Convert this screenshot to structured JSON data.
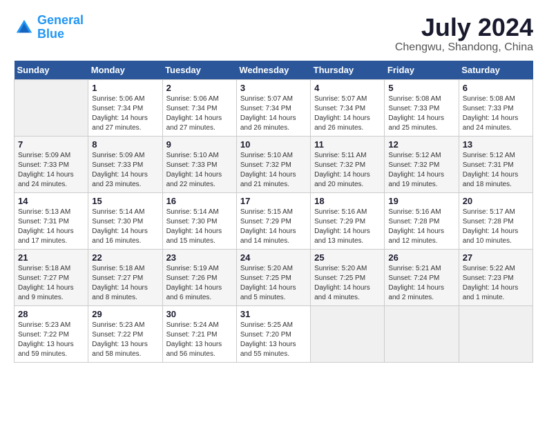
{
  "logo": {
    "line1": "General",
    "line2": "Blue"
  },
  "title": "July 2024",
  "subtitle": "Chengwu, Shandong, China",
  "days_of_week": [
    "Sunday",
    "Monday",
    "Tuesday",
    "Wednesday",
    "Thursday",
    "Friday",
    "Saturday"
  ],
  "weeks": [
    [
      {
        "num": "",
        "info": ""
      },
      {
        "num": "1",
        "info": "Sunrise: 5:06 AM\nSunset: 7:34 PM\nDaylight: 14 hours\nand 27 minutes."
      },
      {
        "num": "2",
        "info": "Sunrise: 5:06 AM\nSunset: 7:34 PM\nDaylight: 14 hours\nand 27 minutes."
      },
      {
        "num": "3",
        "info": "Sunrise: 5:07 AM\nSunset: 7:34 PM\nDaylight: 14 hours\nand 26 minutes."
      },
      {
        "num": "4",
        "info": "Sunrise: 5:07 AM\nSunset: 7:34 PM\nDaylight: 14 hours\nand 26 minutes."
      },
      {
        "num": "5",
        "info": "Sunrise: 5:08 AM\nSunset: 7:33 PM\nDaylight: 14 hours\nand 25 minutes."
      },
      {
        "num": "6",
        "info": "Sunrise: 5:08 AM\nSunset: 7:33 PM\nDaylight: 14 hours\nand 24 minutes."
      }
    ],
    [
      {
        "num": "7",
        "info": "Sunrise: 5:09 AM\nSunset: 7:33 PM\nDaylight: 14 hours\nand 24 minutes."
      },
      {
        "num": "8",
        "info": "Sunrise: 5:09 AM\nSunset: 7:33 PM\nDaylight: 14 hours\nand 23 minutes."
      },
      {
        "num": "9",
        "info": "Sunrise: 5:10 AM\nSunset: 7:33 PM\nDaylight: 14 hours\nand 22 minutes."
      },
      {
        "num": "10",
        "info": "Sunrise: 5:10 AM\nSunset: 7:32 PM\nDaylight: 14 hours\nand 21 minutes."
      },
      {
        "num": "11",
        "info": "Sunrise: 5:11 AM\nSunset: 7:32 PM\nDaylight: 14 hours\nand 20 minutes."
      },
      {
        "num": "12",
        "info": "Sunrise: 5:12 AM\nSunset: 7:32 PM\nDaylight: 14 hours\nand 19 minutes."
      },
      {
        "num": "13",
        "info": "Sunrise: 5:12 AM\nSunset: 7:31 PM\nDaylight: 14 hours\nand 18 minutes."
      }
    ],
    [
      {
        "num": "14",
        "info": "Sunrise: 5:13 AM\nSunset: 7:31 PM\nDaylight: 14 hours\nand 17 minutes."
      },
      {
        "num": "15",
        "info": "Sunrise: 5:14 AM\nSunset: 7:30 PM\nDaylight: 14 hours\nand 16 minutes."
      },
      {
        "num": "16",
        "info": "Sunrise: 5:14 AM\nSunset: 7:30 PM\nDaylight: 14 hours\nand 15 minutes."
      },
      {
        "num": "17",
        "info": "Sunrise: 5:15 AM\nSunset: 7:29 PM\nDaylight: 14 hours\nand 14 minutes."
      },
      {
        "num": "18",
        "info": "Sunrise: 5:16 AM\nSunset: 7:29 PM\nDaylight: 14 hours\nand 13 minutes."
      },
      {
        "num": "19",
        "info": "Sunrise: 5:16 AM\nSunset: 7:28 PM\nDaylight: 14 hours\nand 12 minutes."
      },
      {
        "num": "20",
        "info": "Sunrise: 5:17 AM\nSunset: 7:28 PM\nDaylight: 14 hours\nand 10 minutes."
      }
    ],
    [
      {
        "num": "21",
        "info": "Sunrise: 5:18 AM\nSunset: 7:27 PM\nDaylight: 14 hours\nand 9 minutes."
      },
      {
        "num": "22",
        "info": "Sunrise: 5:18 AM\nSunset: 7:27 PM\nDaylight: 14 hours\nand 8 minutes."
      },
      {
        "num": "23",
        "info": "Sunrise: 5:19 AM\nSunset: 7:26 PM\nDaylight: 14 hours\nand 6 minutes."
      },
      {
        "num": "24",
        "info": "Sunrise: 5:20 AM\nSunset: 7:25 PM\nDaylight: 14 hours\nand 5 minutes."
      },
      {
        "num": "25",
        "info": "Sunrise: 5:20 AM\nSunset: 7:25 PM\nDaylight: 14 hours\nand 4 minutes."
      },
      {
        "num": "26",
        "info": "Sunrise: 5:21 AM\nSunset: 7:24 PM\nDaylight: 14 hours\nand 2 minutes."
      },
      {
        "num": "27",
        "info": "Sunrise: 5:22 AM\nSunset: 7:23 PM\nDaylight: 14 hours\nand 1 minute."
      }
    ],
    [
      {
        "num": "28",
        "info": "Sunrise: 5:23 AM\nSunset: 7:22 PM\nDaylight: 13 hours\nand 59 minutes."
      },
      {
        "num": "29",
        "info": "Sunrise: 5:23 AM\nSunset: 7:22 PM\nDaylight: 13 hours\nand 58 minutes."
      },
      {
        "num": "30",
        "info": "Sunrise: 5:24 AM\nSunset: 7:21 PM\nDaylight: 13 hours\nand 56 minutes."
      },
      {
        "num": "31",
        "info": "Sunrise: 5:25 AM\nSunset: 7:20 PM\nDaylight: 13 hours\nand 55 minutes."
      },
      {
        "num": "",
        "info": ""
      },
      {
        "num": "",
        "info": ""
      },
      {
        "num": "",
        "info": ""
      }
    ]
  ]
}
